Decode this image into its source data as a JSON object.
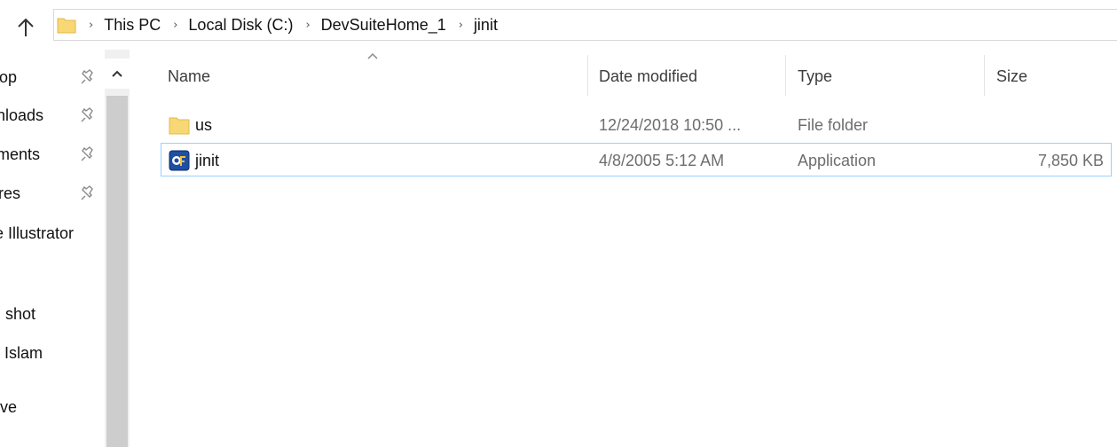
{
  "address_bar": {
    "crumbs": [
      "This PC",
      "Local Disk (C:)",
      "DevSuiteHome_1",
      "jinit"
    ]
  },
  "nav_pane": {
    "items": [
      {
        "label": "top",
        "pinned": true
      },
      {
        "label": "nloads",
        "pinned": true
      },
      {
        "label": "ments",
        "pinned": true
      },
      {
        "label": "res",
        "pinned": true
      },
      {
        "label": "e Illustrator",
        "pinned": false
      },
      {
        "label": "shot",
        "pinned": false
      },
      {
        "label": "l Islam",
        "pinned": false
      },
      {
        "label": "ive",
        "pinned": false
      }
    ]
  },
  "columns": {
    "name": "Name",
    "date_modified": "Date modified",
    "type": "Type",
    "size": "Size"
  },
  "files": [
    {
      "name": "us",
      "date": "12/24/2018 10:50 ...",
      "type": "File folder",
      "size": "",
      "icon": "folder-icon",
      "selected": false
    },
    {
      "name": "jinit",
      "date": "4/8/2005 5:12 AM",
      "type": "Application",
      "size": "7,850 KB",
      "icon": "application-icon",
      "selected": true
    }
  ],
  "colors": {
    "folder": "#f8d775",
    "selection_border": "#99d1ff",
    "scrollbar_thumb": "#cdcdcd"
  }
}
